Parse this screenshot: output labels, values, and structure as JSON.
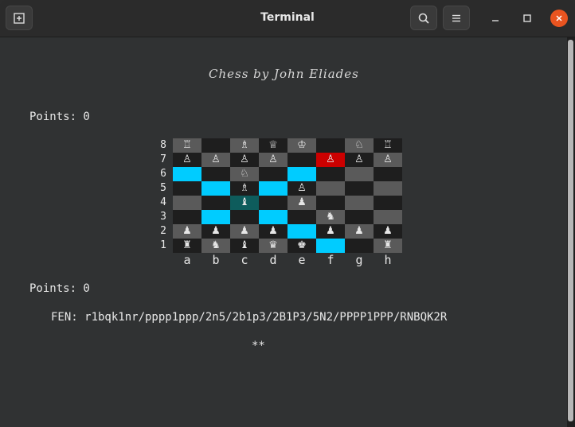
{
  "window": {
    "title": "Terminal"
  },
  "terminal": {
    "banner": "Chess by John Eliades",
    "points_top": "Points: 0",
    "points_bottom": "Points: 0",
    "fen_line": "FEN: r1bqk1nr/pppp1ppp/2n5/2b1p3/2B1P3/5N2/PPPP1PPP/RNBQK2R",
    "stars": "**"
  },
  "board": {
    "rank_labels": [
      "8",
      "7",
      "6",
      "5",
      "4",
      "3",
      "2",
      "1"
    ],
    "file_labels": [
      "a",
      "b",
      "c",
      "d",
      "e",
      "f",
      "g",
      "h"
    ],
    "colors": {
      "light": "#5a5a5a",
      "dark": "#1e1e1e",
      "highlight": "#00ccff",
      "selected": "#0e5c5c",
      "check": "#cc0000",
      "piece_light": "#e6e6e6",
      "piece_outline": "#e6e6e6"
    },
    "rows": [
      [
        {
          "glyph": "♖",
          "bg": "light",
          "piece": "white-rook"
        },
        {
          "glyph": "",
          "bg": "dark"
        },
        {
          "glyph": "♗",
          "bg": "light",
          "piece": "white-bishop"
        },
        {
          "glyph": "♕",
          "bg": "dark",
          "piece": "white-queen"
        },
        {
          "glyph": "♔",
          "bg": "light",
          "piece": "white-king"
        },
        {
          "glyph": "",
          "bg": "dark"
        },
        {
          "glyph": "♘",
          "bg": "light",
          "piece": "white-knight"
        },
        {
          "glyph": "♖",
          "bg": "dark",
          "piece": "white-rook"
        }
      ],
      [
        {
          "glyph": "♙",
          "bg": "dark",
          "piece": "white-pawn"
        },
        {
          "glyph": "♙",
          "bg": "light",
          "piece": "white-pawn"
        },
        {
          "glyph": "♙",
          "bg": "dark",
          "piece": "white-pawn"
        },
        {
          "glyph": "♙",
          "bg": "light",
          "piece": "white-pawn"
        },
        {
          "glyph": "",
          "bg": "dark"
        },
        {
          "glyph": "♙",
          "bg": "check",
          "piece": "white-pawn"
        },
        {
          "glyph": "♙",
          "bg": "dark",
          "piece": "white-pawn"
        },
        {
          "glyph": "♙",
          "bg": "light",
          "piece": "white-pawn"
        }
      ],
      [
        {
          "glyph": "",
          "bg": "highlight"
        },
        {
          "glyph": "",
          "bg": "dark"
        },
        {
          "glyph": "♘",
          "bg": "light",
          "piece": "white-knight"
        },
        {
          "glyph": "",
          "bg": "dark"
        },
        {
          "glyph": "",
          "bg": "highlight"
        },
        {
          "glyph": "",
          "bg": "dark"
        },
        {
          "glyph": "",
          "bg": "light"
        },
        {
          "glyph": "",
          "bg": "dark"
        }
      ],
      [
        {
          "glyph": "",
          "bg": "dark"
        },
        {
          "glyph": "",
          "bg": "highlight"
        },
        {
          "glyph": "♗",
          "bg": "dark",
          "piece": "white-bishop"
        },
        {
          "glyph": "",
          "bg": "highlight"
        },
        {
          "glyph": "♙",
          "bg": "dark",
          "piece": "white-pawn"
        },
        {
          "glyph": "",
          "bg": "light"
        },
        {
          "glyph": "",
          "bg": "dark"
        },
        {
          "glyph": "",
          "bg": "light"
        }
      ],
      [
        {
          "glyph": "",
          "bg": "light"
        },
        {
          "glyph": "",
          "bg": "dark"
        },
        {
          "glyph": "♝",
          "bg": "selected",
          "piece": "black-bishop"
        },
        {
          "glyph": "",
          "bg": "dark"
        },
        {
          "glyph": "♟",
          "bg": "light",
          "piece": "black-pawn"
        },
        {
          "glyph": "",
          "bg": "dark"
        },
        {
          "glyph": "",
          "bg": "light"
        },
        {
          "glyph": "",
          "bg": "dark"
        }
      ],
      [
        {
          "glyph": "",
          "bg": "dark"
        },
        {
          "glyph": "",
          "bg": "highlight"
        },
        {
          "glyph": "",
          "bg": "dark"
        },
        {
          "glyph": "",
          "bg": "highlight"
        },
        {
          "glyph": "",
          "bg": "dark"
        },
        {
          "glyph": "♞",
          "bg": "light",
          "piece": "black-knight"
        },
        {
          "glyph": "",
          "bg": "dark"
        },
        {
          "glyph": "",
          "bg": "light"
        }
      ],
      [
        {
          "glyph": "♟",
          "bg": "light",
          "piece": "black-pawn"
        },
        {
          "glyph": "♟",
          "bg": "dark",
          "piece": "black-pawn"
        },
        {
          "glyph": "♟",
          "bg": "light",
          "piece": "black-pawn"
        },
        {
          "glyph": "♟",
          "bg": "dark",
          "piece": "black-pawn"
        },
        {
          "glyph": "",
          "bg": "highlight"
        },
        {
          "glyph": "♟",
          "bg": "dark",
          "piece": "black-pawn"
        },
        {
          "glyph": "♟",
          "bg": "light",
          "piece": "black-pawn"
        },
        {
          "glyph": "♟",
          "bg": "dark",
          "piece": "black-pawn"
        }
      ],
      [
        {
          "glyph": "♜",
          "bg": "dark",
          "piece": "black-rook"
        },
        {
          "glyph": "♞",
          "bg": "light",
          "piece": "black-knight"
        },
        {
          "glyph": "♝",
          "bg": "dark",
          "piece": "black-bishop"
        },
        {
          "glyph": "♛",
          "bg": "light",
          "piece": "black-queen"
        },
        {
          "glyph": "♚",
          "bg": "dark",
          "piece": "black-king"
        },
        {
          "glyph": "",
          "bg": "highlight"
        },
        {
          "glyph": "",
          "bg": "dark"
        },
        {
          "glyph": "♜",
          "bg": "light",
          "piece": "black-rook"
        }
      ]
    ]
  },
  "icons": {
    "new_tab": "new-tab-icon",
    "search": "search-icon",
    "menu": "hamburger-menu-icon",
    "minimize": "minimize-icon",
    "maximize": "maximize-icon",
    "close": "close-icon"
  }
}
